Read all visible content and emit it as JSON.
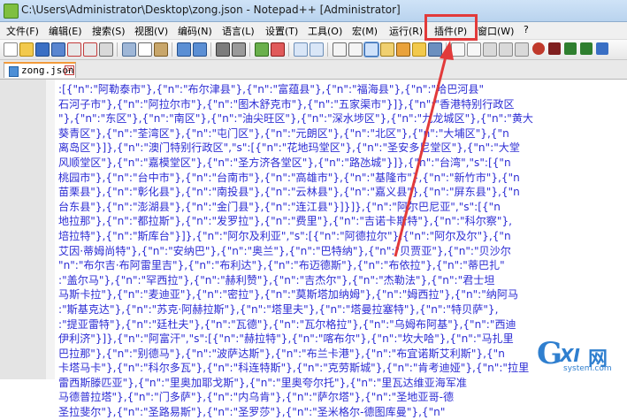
{
  "window": {
    "title": "C:\\Users\\Administrator\\Desktop\\zong.json - Notepad++ [Administrator]"
  },
  "menu": [
    "文件(F)",
    "编辑(E)",
    "搜索(S)",
    "视图(V)",
    "编码(N)",
    "语言(L)",
    "设置(T)",
    "工具(O)",
    "宏(M)",
    "运行(R)",
    "插件(P)",
    "窗口(W)",
    "?"
  ],
  "tab": {
    "label": "zong.json"
  },
  "editor": {
    "lines": [
      ":[{\"n\":\"阿勒泰市\"},{\"n\":\"布尔津县\"},{\"n\":\"富蕴县\"},{\"n\":\"福海县\"},{\"n\":\"哈巴河县\"",
      "石河子市\"},{\"n\":\"阿拉尔市\"},{\"n\":\"图木舒克市\"},{\"n\":\"五家渠市\"}]},{\"n\":\"香港特别行政区",
      "\"},{\"n\":\"东区\"},{\"n\":\"南区\"},{\"n\":\"油尖旺区\"},{\"n\":\"深水埗区\"},{\"n\":\"九龙城区\"},{\"n\":\"黄大",
      "葵青区\"},{\"n\":\"荃湾区\"},{\"n\":\"屯门区\"},{\"n\":\"元朗区\"},{\"n\":\"北区\"},{\"n\":\"大埔区\"},{\"n",
      "离岛区\"}]},{\"n\":\"澳门特别行政区\",\"s\":[{\"n\":\"花地玛堂区\"},{\"n\":\"圣安多尼堂区\"},{\"n\":\"大堂",
      "风顺堂区\"},{\"n\":\"嘉模堂区\"},{\"n\":\"圣方济各堂区\"},{\"n\":\"路氹城\"}]},{\"n\":\"台湾\",\"s\":[{\"n",
      "桃园市\"},{\"n\":\"台中市\"},{\"n\":\"台南市\"},{\"n\":\"高雄市\"},{\"n\":\"基隆市\"},{\"n\":\"新竹市\"},{\"n",
      "苗栗县\"},{\"n\":\"彰化县\"},{\"n\":\"南投县\"},{\"n\":\"云林县\"},{\"n\":\"嘉义县\"},{\"n\":\"屏东县\"},{\"n",
      "台东县\"},{\"n\":\"澎湖县\"},{\"n\":\"金门县\"},{\"n\":\"连江县\"}]}]},{\"n\":\"阿尔巴尼亚\",\"s\":[{\"n",
      "地拉那\"},{\"n\":\"都拉斯\"},{\"n\":\"发罗拉\"},{\"n\":\"费里\"},{\"n\":\"吉诺卡斯特\"},{\"n\":\"科尔察\"},",
      "培拉特\"},{\"n\":\"斯库台\"}]},{\"n\":\"阿尔及利亚\",\"s\":[{\"n\":\"阿德拉尔\"},{\"n\":\"阿尔及尔\"},{\"n",
      "艾因·蒂姆尚特\"},{\"n\":\"安纳巴\"},{\"n\":\"奥兰\"},{\"n\":\"巴特纳\"},{\"n\":\"贝贾亚\"},{\"n\":\"贝沙尔",
      "\"n\":\"布尔吉·布阿雷里吉\"},{\"n\":\"布利达\"},{\"n\":\"布迈德斯\"},{\"n\":\"布依拉\"},{\"n\":\"蒂巴扎\"",
      ":\"盖尔马\"},{\"n\":\"罕西拉\"},{\"n\":\"赫利赞\"},{\"n\":\"吉杰尔\"},{\"n\":\"杰勒法\"},{\"n\":\"君士坦",
      "马斯卡拉\"},{\"n\":\"麦迪亚\"},{\"n\":\"密拉\"},{\"n\":\"莫斯塔加纳姆\"},{\"n\":\"姆西拉\"},{\"n\":\"纳阿马",
      ":\"斯基克达\"},{\"n\":\"苏克·阿赫拉斯\"},{\"n\":\"塔里夫\"},{\"n\":\"塔曼拉塞特\"},{\"n\":\"特贝萨\"},",
      ":\"提亚雷特\"},{\"n\":\"廷杜夫\"},{\"n\":\"瓦德\"},{\"n\":\"瓦尔格拉\"},{\"n\":\"乌姆布阿基\"},{\"n\":\"西迪",
      "伊利济\"}]},{\"n\":\"阿富汗\",\"s\":[{\"n\":\"赫拉特\"},{\"n\":\"喀布尔\"},{\"n\":\"坎大哈\"},{\"n\":\"马扎里",
      "巴拉那\"},{\"n\":\"别德马\"},{\"n\":\"波萨达斯\"},{\"n\":\"布兰卡港\"},{\"n\":\"布宜诺斯艾利斯\"},{\"n",
      "卡塔马卡\"},{\"n\":\"科尔多瓦\"},{\"n\":\"科连特斯\"},{\"n\":\"克劳斯城\"},{\"n\":\"肯考迪娅\"},{\"n\":\"拉里",
      "雷西斯滕匹亚\"},{\"n\":\"里奥加耶戈斯\"},{\"n\":\"里奥夸尔托\"},{\"n\":\"里瓦达维亚海军准",
      "马德普拉塔\"},{\"n\":\"门多萨\"},{\"n\":\"内乌肯\"},{\"n\":\"萨尔塔\"},{\"n\":\"圣地亚哥-德",
      "圣拉斐尔\"},{\"n\":\"圣路易斯\"},{\"n\":\"圣罗莎\"},{\"n\":\"圣米格尔-德图库曼\"},{\"n\""
    ]
  },
  "icons": [
    "new-file-icon",
    "open-file-icon",
    "save-icon",
    "save-all-icon",
    "close-icon",
    "close-all-icon",
    "print-icon",
    "cut-icon",
    "copy-icon",
    "paste-icon",
    "undo-icon",
    "redo-icon",
    "find-icon",
    "replace-icon",
    "zoom-in-icon",
    "zoom-out-icon",
    "sync-vertical-icon",
    "sync-horizontal-icon",
    "word-wrap-icon",
    "show-all-chars-icon",
    "indent-guide-icon",
    "doc-map-icon",
    "function-list-icon",
    "folder-workspace-icon",
    "monitor-icon",
    "record-macro-icon",
    "stop-record-icon",
    "play-macro-icon",
    "play-multiple-icon",
    "save-macro-icon"
  ],
  "colors": {
    "highlight": "#e23a3a",
    "text": "#2d2dd4",
    "watermark": "#2f7fcf"
  },
  "watermark": {
    "g": "G",
    "xi": "XI",
    "wang": "网",
    "domain": "system.com"
  }
}
